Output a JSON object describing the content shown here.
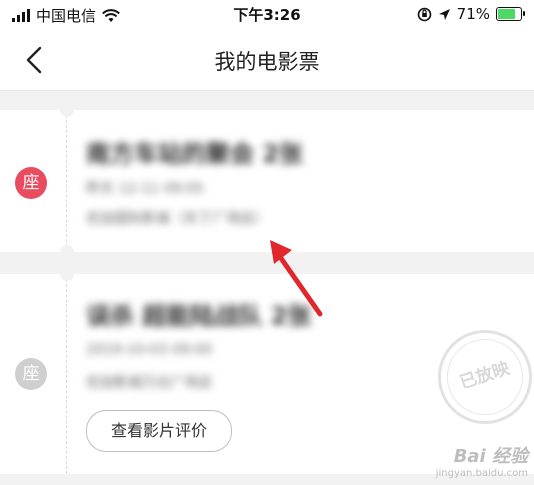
{
  "status_bar": {
    "carrier": "中国电信",
    "time": "下午3:26",
    "battery": "71%"
  },
  "navbar": {
    "title": "我的电影票"
  },
  "tickets": [
    {
      "seat_label": "座",
      "title": "南方车站的聚会 2张",
      "time": "昨天 12-11 09:05",
      "cinema": "优加国际影城（东丁广场店）",
      "badge_color": "#e94b5f"
    },
    {
      "seat_label": "座",
      "title": "误杀 超能陆战队 2张",
      "time": "2019-10-03 09:00",
      "cinema": "优加影城万达广场店",
      "review_button": "查看影片评价",
      "stamp_text": "已放映",
      "badge_color": "#cfcfcf"
    }
  ],
  "watermark": {
    "brand": "Bai 经验",
    "url": "jingyan.baidu.com"
  },
  "colors": {
    "accent": "#e94b5f",
    "arrow": "#e0282c"
  }
}
